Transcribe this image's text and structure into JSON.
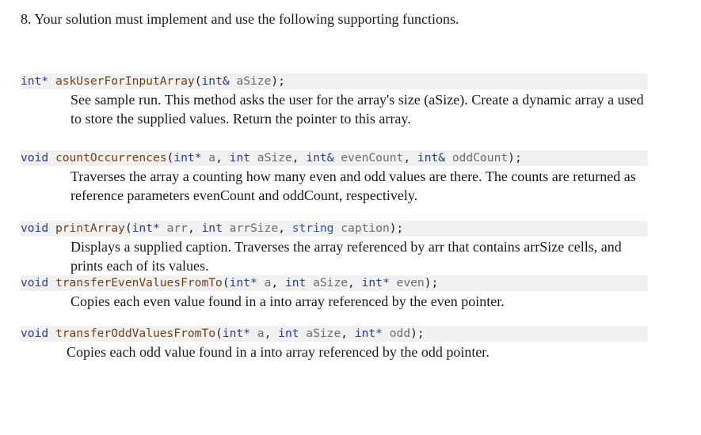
{
  "heading": "8. Your solution must implement and use the following supporting functions.",
  "functions": [
    {
      "id": "askUserForInputArray",
      "signature": [
        {
          "t": "int*",
          "c": "kw"
        },
        {
          "t": " ",
          "c": "pl"
        },
        {
          "t": "askUserForInputArray",
          "c": "fn"
        },
        {
          "t": "(",
          "c": "pl"
        },
        {
          "t": "int&",
          "c": "kw"
        },
        {
          "t": " aSize",
          "c": "pm"
        },
        {
          "t": ");",
          "c": "pl"
        }
      ],
      "description": "See sample run. This method asks the user for the array's size (aSize). Create a dynamic array a used to store the supplied values. Return the pointer to this array."
    },
    {
      "id": "countOccurrences",
      "signature": [
        {
          "t": "void",
          "c": "kw"
        },
        {
          "t": " ",
          "c": "pl"
        },
        {
          "t": "countOccurrences",
          "c": "fn"
        },
        {
          "t": "(",
          "c": "pl"
        },
        {
          "t": "int*",
          "c": "kw"
        },
        {
          "t": " a",
          "c": "pm"
        },
        {
          "t": ", ",
          "c": "pl"
        },
        {
          "t": "int",
          "c": "kw"
        },
        {
          "t": " aSize",
          "c": "pm"
        },
        {
          "t": ", ",
          "c": "pl"
        },
        {
          "t": "int&",
          "c": "kw"
        },
        {
          "t": " evenCount",
          "c": "pm"
        },
        {
          "t": ", ",
          "c": "pl"
        },
        {
          "t": "int&",
          "c": "kw"
        },
        {
          "t": " oddCount",
          "c": "pm"
        },
        {
          "t": ");",
          "c": "pl"
        }
      ],
      "description": "Traverses the array a counting how many even and odd values are there. The counts are returned as reference parameters evenCount and oddCount, respectively."
    },
    {
      "id": "printArray",
      "signature": [
        {
          "t": "void",
          "c": "kw"
        },
        {
          "t": " ",
          "c": "pl"
        },
        {
          "t": "printArray",
          "c": "fn"
        },
        {
          "t": "(",
          "c": "pl"
        },
        {
          "t": "int*",
          "c": "kw"
        },
        {
          "t": " arr",
          "c": "pm"
        },
        {
          "t": ", ",
          "c": "pl"
        },
        {
          "t": "int",
          "c": "kw"
        },
        {
          "t": " arrSize",
          "c": "pm"
        },
        {
          "t": ", ",
          "c": "pl"
        },
        {
          "t": "string",
          "c": "ty"
        },
        {
          "t": " caption",
          "c": "pm"
        },
        {
          "t": ");",
          "c": "pl"
        }
      ],
      "description": "Displays a supplied caption. Traverses the array referenced by arr that contains arrSize cells, and prints each of its values."
    },
    {
      "id": "transferEvenValuesFromTo",
      "signature": [
        {
          "t": "void",
          "c": "kw"
        },
        {
          "t": " ",
          "c": "pl"
        },
        {
          "t": "transferEvenValuesFromTo",
          "c": "fn"
        },
        {
          "t": "(",
          "c": "pl"
        },
        {
          "t": "int*",
          "c": "kw"
        },
        {
          "t": " a",
          "c": "pm"
        },
        {
          "t": ", ",
          "c": "pl"
        },
        {
          "t": "int",
          "c": "kw"
        },
        {
          "t": " aSize",
          "c": "pm"
        },
        {
          "t": ", ",
          "c": "pl"
        },
        {
          "t": "int*",
          "c": "kw"
        },
        {
          "t": " even",
          "c": "pm"
        },
        {
          "t": ");",
          "c": "pl"
        }
      ],
      "description": "Copies each even value found in a into array referenced by the even pointer."
    },
    {
      "id": "transferOddValuesFromTo",
      "signature": [
        {
          "t": "void",
          "c": "kw"
        },
        {
          "t": " ",
          "c": "pl"
        },
        {
          "t": "transferOddValuesFromTo",
          "c": "fn"
        },
        {
          "t": "(",
          "c": "pl"
        },
        {
          "t": "int*",
          "c": "kw"
        },
        {
          "t": " a",
          "c": "pm"
        },
        {
          "t": ", ",
          "c": "pl"
        },
        {
          "t": "int",
          "c": "kw"
        },
        {
          "t": " aSize",
          "c": "pm"
        },
        {
          "t": ", ",
          "c": "pl"
        },
        {
          "t": "int*",
          "c": "kw"
        },
        {
          "t": " odd",
          "c": "pm"
        },
        {
          "t": ");",
          "c": "pl"
        }
      ],
      "description": "Copies each odd value found in a into array referenced by the odd pointer."
    }
  ]
}
